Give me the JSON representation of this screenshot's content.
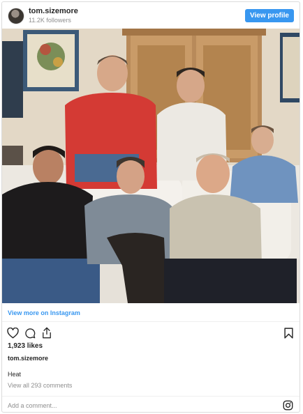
{
  "header": {
    "username": "tom.sizemore",
    "followers": "11.2K followers",
    "view_profile_label": "View profile"
  },
  "post": {
    "image_alt": "",
    "view_more_label": "View more on Instagram",
    "likes": "1,923 likes",
    "owner": "tom.sizemore",
    "caption": "Heat",
    "view_comments": "View all 293 comments"
  },
  "comment": {
    "placeholder": "Add a comment..."
  },
  "icons": {
    "like": "heart-icon",
    "comment": "comment-bubble-icon",
    "share": "share-icon",
    "save": "bookmark-icon",
    "instagram": "instagram-logo-icon"
  },
  "colors": {
    "accent": "#3897f0",
    "muted_text": "#8e8e8e",
    "text": "#262626"
  }
}
